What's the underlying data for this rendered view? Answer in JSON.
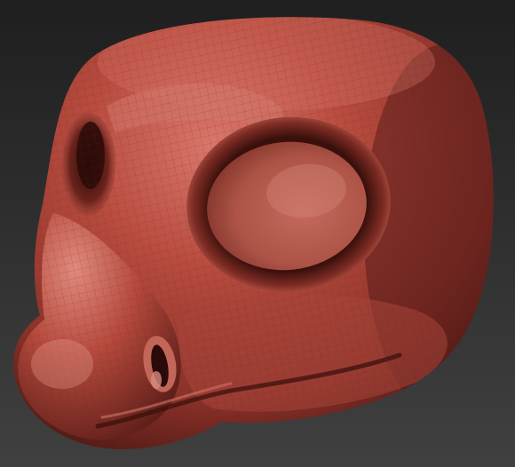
{
  "viewport": {
    "background_top": "#1f1f1f",
    "background_bottom": "#404040",
    "material": {
      "base": "#b0473a",
      "highlight": "#e58e82",
      "shadow": "#4a1713",
      "deep_shadow": "#2a0b09",
      "wireframe": "#7a2a22"
    },
    "model": "sculpted-head-mesh"
  }
}
